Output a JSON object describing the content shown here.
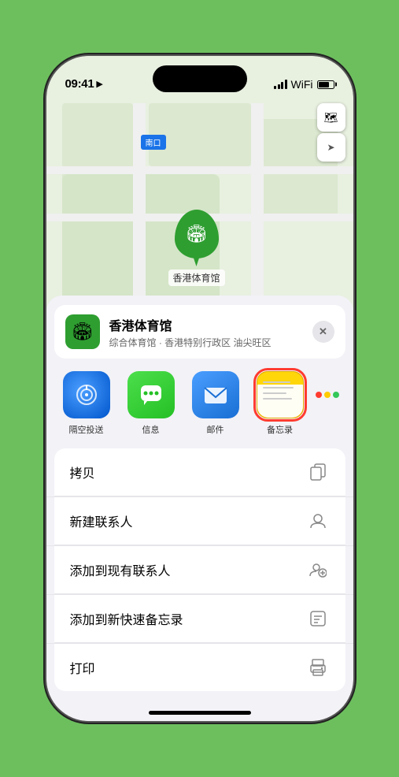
{
  "statusBar": {
    "time": "09:41",
    "timeIcon": "location-arrow"
  },
  "mapControls": {
    "mapIcon": "🗺",
    "locationIcon": "➤"
  },
  "mapLabel": {
    "entrance": "南口"
  },
  "pin": {
    "label": "香港体育馆",
    "stadiumEmoji": "🏟"
  },
  "locationCard": {
    "name": "香港体育馆",
    "subtitle": "综合体育馆 · 香港特别行政区 油尖旺区",
    "closeLabel": "✕"
  },
  "apps": [
    {
      "id": "airdrop",
      "label": "隔空投送",
      "selected": false
    },
    {
      "id": "messages",
      "label": "信息",
      "selected": false
    },
    {
      "id": "mail",
      "label": "邮件",
      "selected": false
    },
    {
      "id": "notes",
      "label": "备忘录",
      "selected": true
    }
  ],
  "moreDots": {
    "colors": [
      "#ff3b30",
      "#ffcc00",
      "#34c759"
    ]
  },
  "actions": [
    {
      "label": "拷贝",
      "icon": "⎘"
    },
    {
      "label": "新建联系人",
      "icon": "👤"
    },
    {
      "label": "添加到现有联系人",
      "icon": "👤+"
    },
    {
      "label": "添加到新快速备忘录",
      "icon": "📋"
    },
    {
      "label": "打印",
      "icon": "🖨"
    }
  ]
}
